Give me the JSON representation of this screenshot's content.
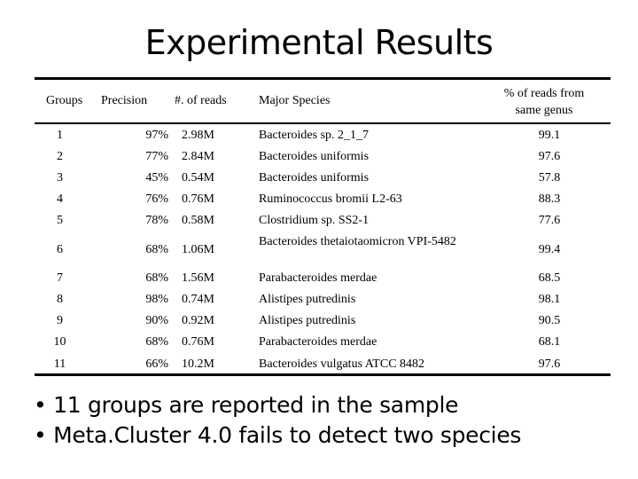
{
  "title": "Experimental Results",
  "table": {
    "headers": {
      "groups": "Groups",
      "precision": "Precision",
      "reads": "#. of reads",
      "species": "Major Species",
      "pct_line1": "% of reads from",
      "pct_line2": "same genus"
    },
    "rows": [
      {
        "group": "1",
        "precision": "97%",
        "reads": "2.98M",
        "species": "Bacteroides sp. 2_1_7",
        "pct": "99.1"
      },
      {
        "group": "2",
        "precision": "77%",
        "reads": "2.84M",
        "species": "Bacteroides uniformis",
        "pct": "97.6"
      },
      {
        "group": "3",
        "precision": "45%",
        "reads": "0.54M",
        "species": "Bacteroides uniformis",
        "pct": "57.8"
      },
      {
        "group": "4",
        "precision": "76%",
        "reads": "0.76M",
        "species": "Ruminococcus bromii L2-63",
        "pct": "88.3"
      },
      {
        "group": "5",
        "precision": "78%",
        "reads": "0.58M",
        "species": "Clostridium sp. SS2-1",
        "pct": "77.6"
      },
      {
        "group": "6",
        "precision": "68%",
        "reads": "1.06M",
        "species": "Bacteroides thetaiotaomicron VPI-5482",
        "pct": "99.4"
      },
      {
        "group": "7",
        "precision": "68%",
        "reads": "1.56M",
        "species": "Parabacteroides merdae",
        "pct": "68.5"
      },
      {
        "group": "8",
        "precision": "98%",
        "reads": "0.74M",
        "species": "Alistipes putredinis",
        "pct": "98.1"
      },
      {
        "group": "9",
        "precision": "90%",
        "reads": "0.92M",
        "species": "Alistipes putredinis",
        "pct": "90.5"
      },
      {
        "group": "10",
        "precision": "68%",
        "reads": "0.76M",
        "species": "Parabacteroides merdae",
        "pct": "68.1"
      },
      {
        "group": "11",
        "precision": "66%",
        "reads": "10.2M",
        "species": "Bacteroides vulgatus ATCC 8482",
        "pct": "97.6"
      }
    ]
  },
  "bullets": [
    "11 groups are reported in the sample",
    "Meta.Cluster 4.0 fails to detect two species"
  ],
  "bullet_glyph": "•"
}
